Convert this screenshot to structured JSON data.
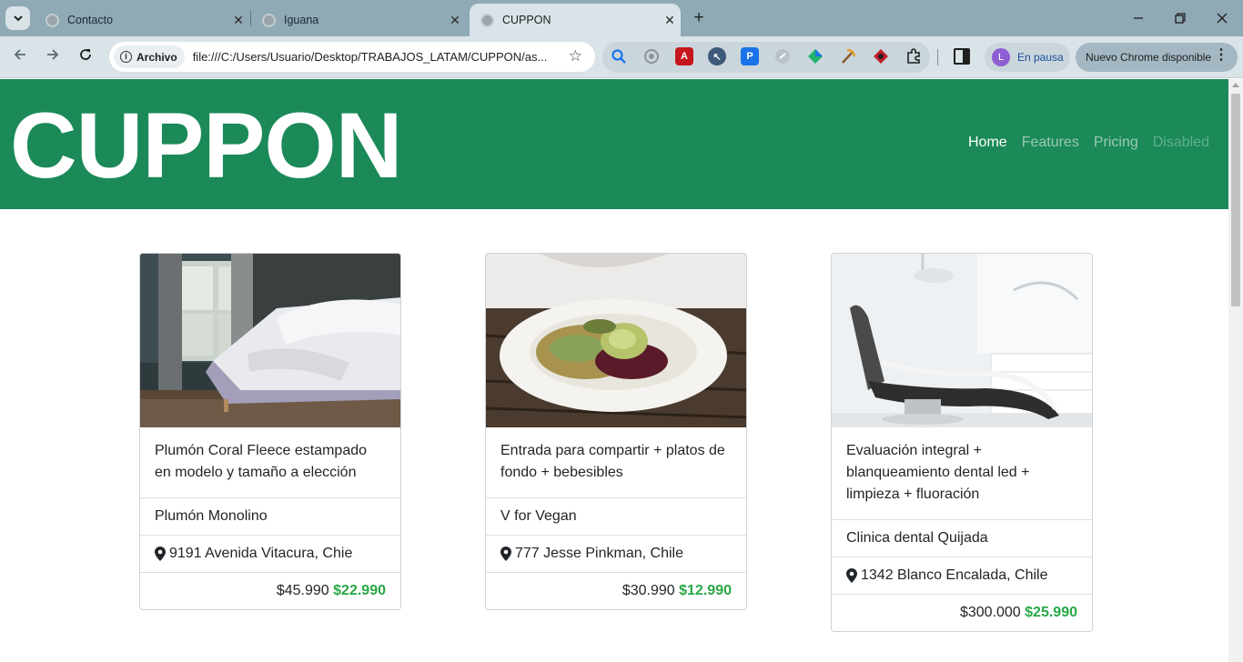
{
  "browser": {
    "tabs": [
      {
        "title": "Contacto",
        "state": "inactive"
      },
      {
        "title": "Iguana",
        "state": "inactive"
      },
      {
        "title": "CUPPON",
        "state": "active"
      }
    ],
    "address_chip": "Archivo",
    "url": "file:///C:/Users/Usuario/Desktop/TRABAJOS_LATAM/CUPPON/as...",
    "profile_label": "En pausa",
    "profile_initial": "L",
    "update_label": "Nuevo Chrome disponible"
  },
  "page": {
    "brand": "CUPPON",
    "nav": [
      {
        "label": "Home",
        "state": "active"
      },
      {
        "label": "Features",
        "state": "normal"
      },
      {
        "label": "Pricing",
        "state": "normal"
      },
      {
        "label": "Disabled",
        "state": "disabled"
      }
    ],
    "cards": [
      {
        "image": "bedroom-photo",
        "description": "Plumón Coral Fleece estampado en modelo y tamaño a elección",
        "merchant": "Plumón Monolino",
        "address": "9191 Avenida Vitacura, Chie",
        "old_price": "$45.990",
        "new_price": "$22.990"
      },
      {
        "image": "vegan-plate-photo",
        "description": "Entrada para compartir + platos de fondo + bebesibles",
        "merchant": "V for Vegan",
        "address": "777 Jesse Pinkman, Chile",
        "old_price": "$30.990",
        "new_price": "$12.990"
      },
      {
        "image": "dental-chair-photo",
        "description": "Evaluación integral + blanqueamiento dental led + limpieza + fluoración",
        "merchant": "Clinica dental Quijada",
        "address": "1342 Blanco Encalada, Chile",
        "old_price": "$300.000",
        "new_price": "$25.990"
      }
    ]
  },
  "colors": {
    "hero_bg": "#1b8a58",
    "price_green": "#28a745",
    "tabbar_bg": "#8fa9b5",
    "toolbar_bg": "#d9e3e8"
  }
}
